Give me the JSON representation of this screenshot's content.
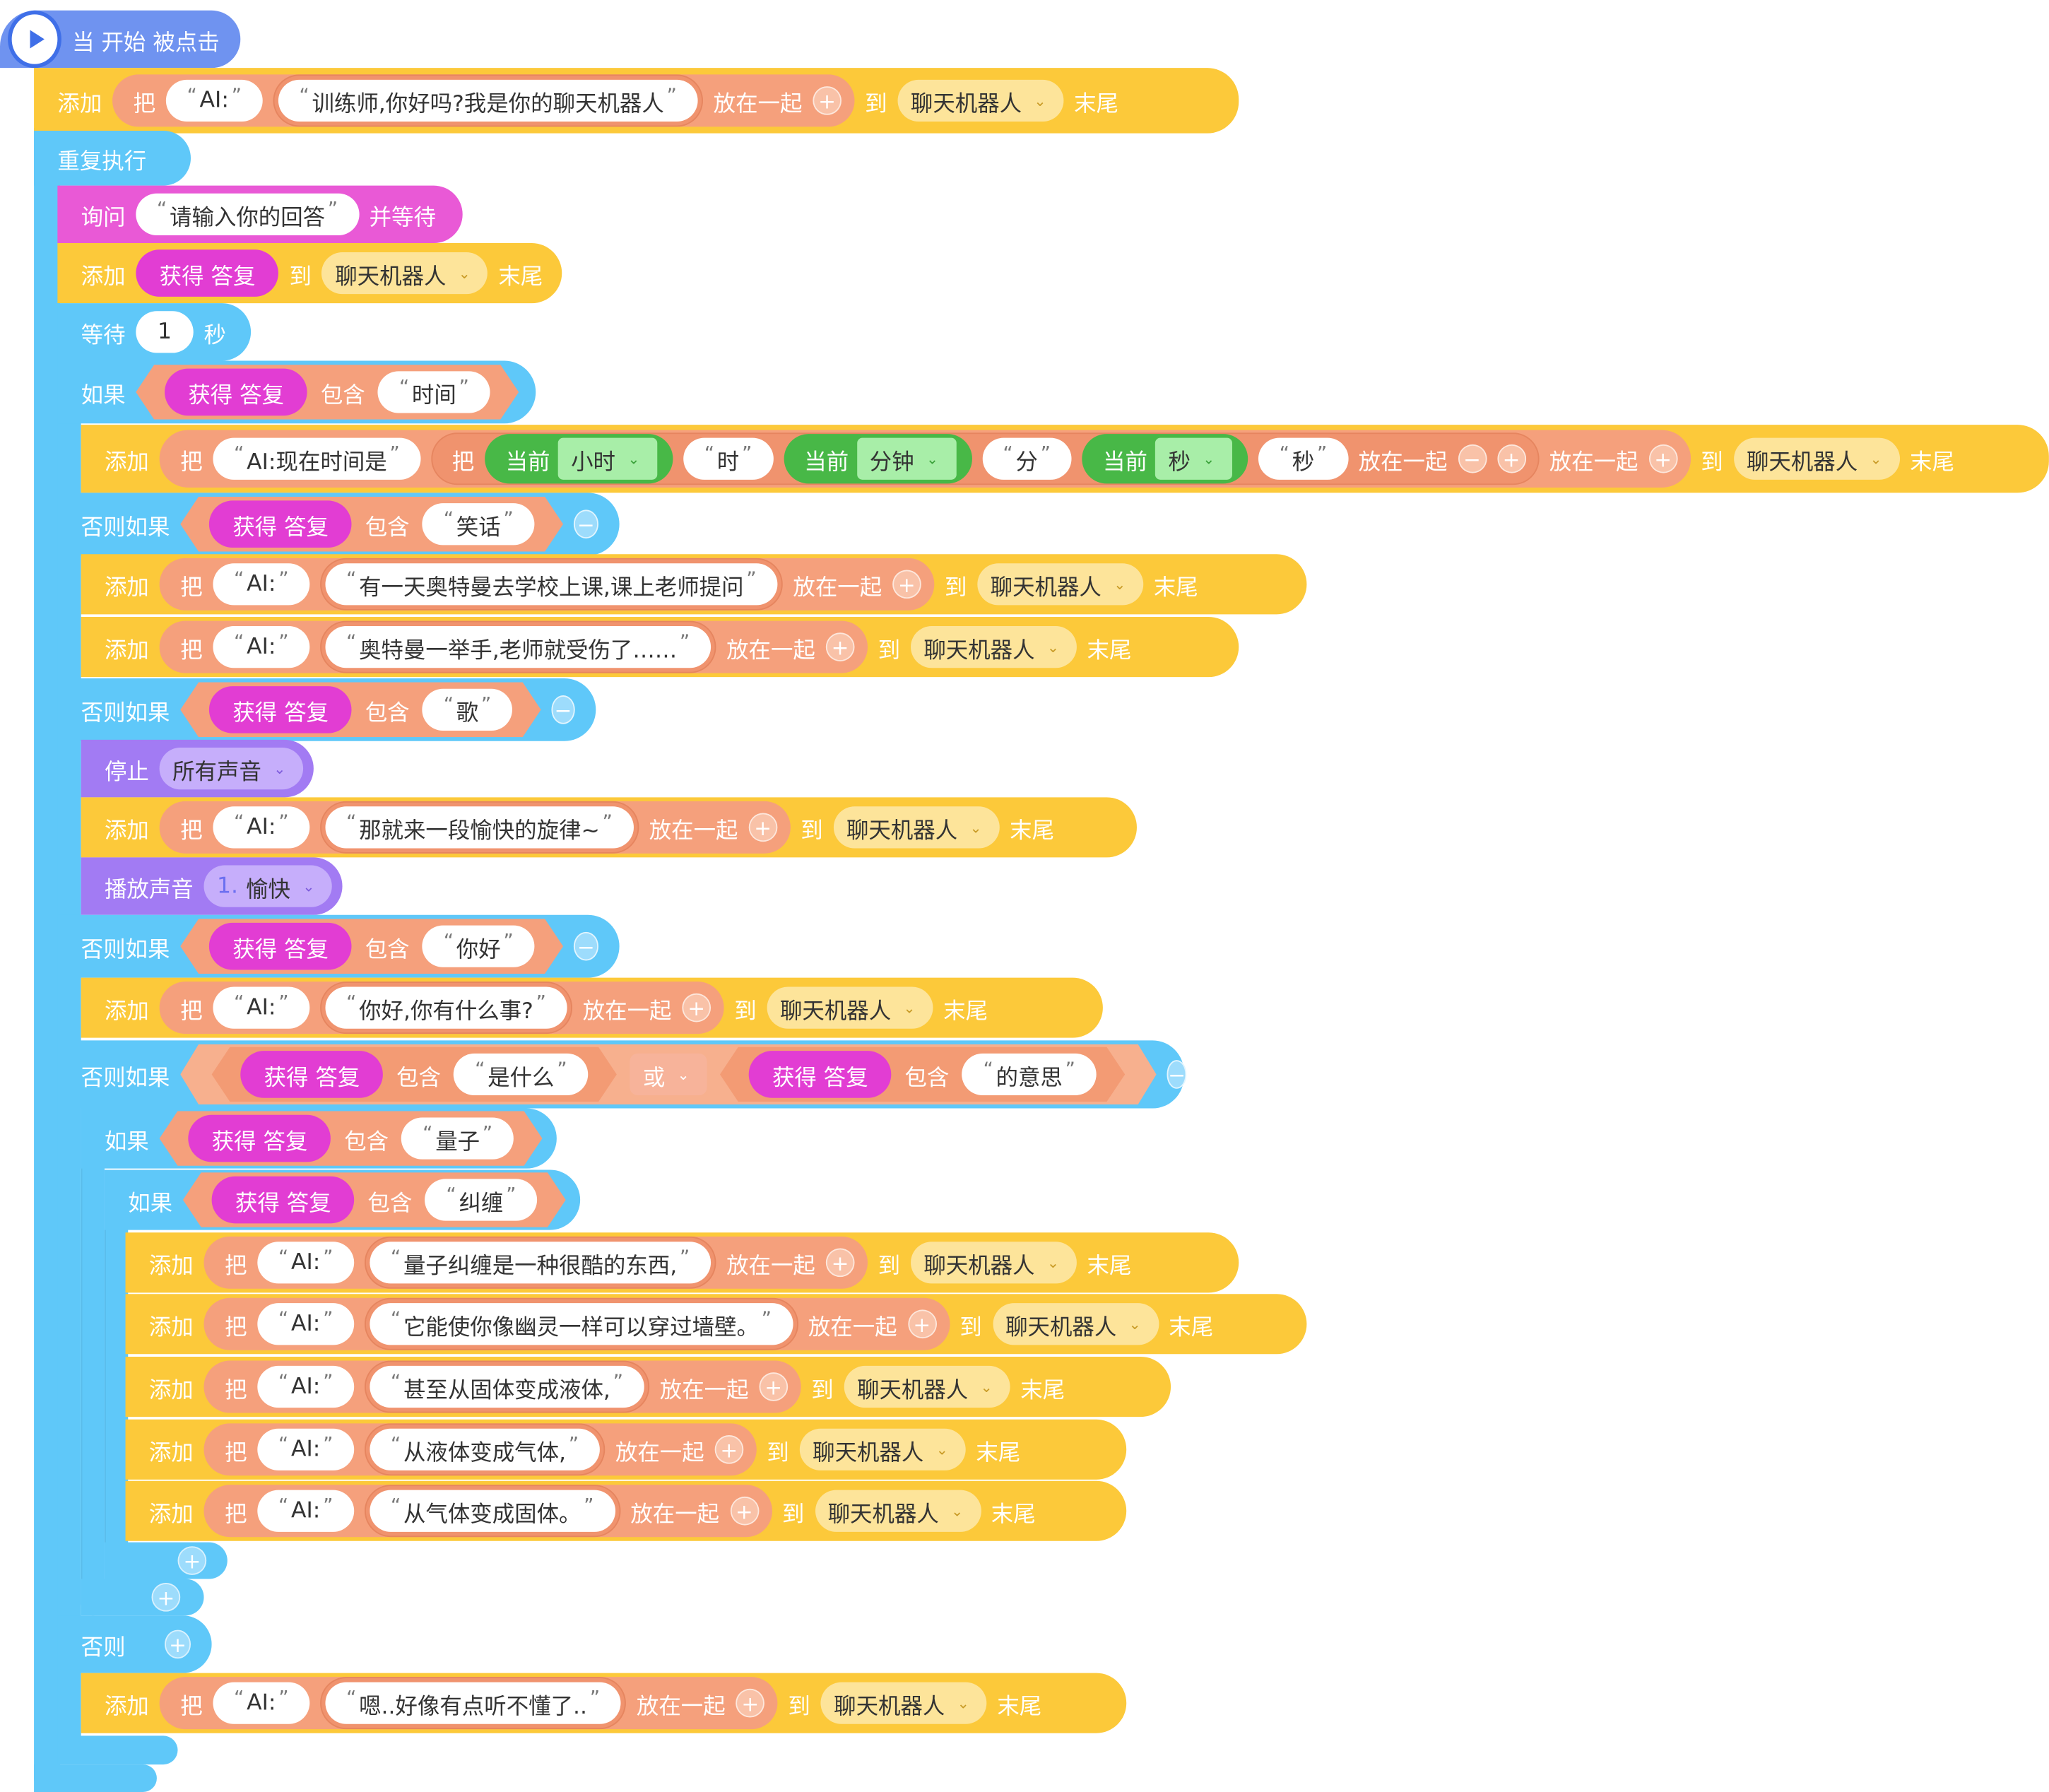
{
  "hat": {
    "label": "当 开始 被点击"
  },
  "kw": {
    "add": "添加",
    "ba": "把",
    "to": "到",
    "end": "末尾",
    "join": "放在一起",
    "repeat": "重复执行",
    "ask": "询问",
    "wait_ask": "并等待",
    "wait": "等待",
    "sec": "秒",
    "if": "如果",
    "elseif": "否则如果",
    "else": "否则",
    "contains": "包含",
    "answer": "获得 答复",
    "current": "当前",
    "or": "或",
    "stop": "停止",
    "play": "播放声音",
    "list": "聊天机器人"
  },
  "ai": "AI:",
  "ai_time": "AI:现在时间是",
  "greet": "训练师,你好吗?我是你的聊天机器人",
  "ask_text": "请输入你的回答",
  "wait_val": "1",
  "cond_time": "时间",
  "time_units": {
    "hour": "小时",
    "minute": "分钟",
    "second": "秒",
    "h": "时",
    "m": "分",
    "s": "秒"
  },
  "cond_joke": "笑话",
  "joke1": "有一天奥特曼去学校上课,课上老师提问",
  "joke2": "奥特曼一举手,老师就受伤了……",
  "cond_song": "歌",
  "all_sounds": "所有声音",
  "song_msg": "那就来一段愉快的旋律~",
  "sound": {
    "num": "1.",
    "name": "愉快"
  },
  "cond_hello": "你好",
  "hello_msg": "你好,你有什么事?",
  "cond_what": "是什么",
  "cond_meaning": "的意思",
  "cond_quantum": "量子",
  "cond_entangle": "纠缠",
  "q1": "量子纠缠是一种很酷的东西,",
  "q2": "它能使你像幽灵一样可以穿过墙壁。",
  "q3": "甚至从固体变成液体,",
  "q4": "从液体变成气体,",
  "q5": "从气体变成固体。",
  "fallback": "嗯..好像有点听不懂了.."
}
